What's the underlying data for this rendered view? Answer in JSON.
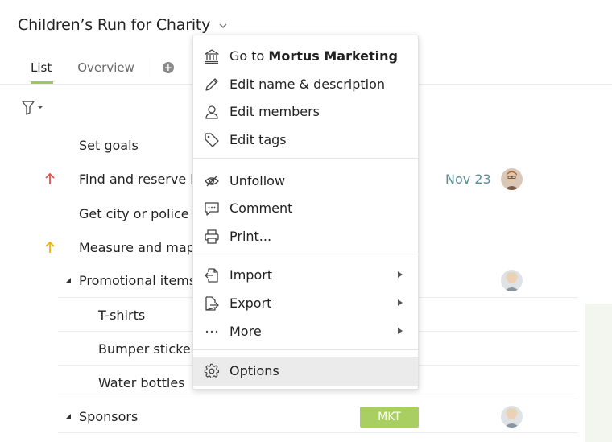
{
  "project": {
    "title": "Children’s Run for Charity"
  },
  "tabs": [
    {
      "label": "List"
    },
    {
      "label": "Overview"
    },
    {
      "label": "+"
    }
  ],
  "tasks": [
    {
      "label": "Set goals"
    },
    {
      "label": "Find and reserve lo",
      "date": "Nov 23",
      "priority": "high"
    },
    {
      "label": "Get city or police ap"
    },
    {
      "label": "Measure and map c",
      "priority": "medium"
    },
    {
      "label": "Promotional items"
    },
    {
      "label": "T-shirts"
    },
    {
      "label": "Bumper stickers"
    },
    {
      "label": "Water bottles"
    },
    {
      "label": "Sponsors",
      "tag": "MKT"
    }
  ],
  "context_menu": {
    "goto_prefix": "Go to ",
    "goto_target": "Mortus Marketing",
    "items": [
      {
        "label": "Edit name & description",
        "icon": "pencil-icon"
      },
      {
        "label": "Edit members",
        "icon": "person-icon"
      },
      {
        "label": "Edit tags",
        "icon": "tag-icon"
      },
      {
        "label": "Unfollow",
        "icon": "unfollow-eye-icon"
      },
      {
        "label": "Comment",
        "icon": "comment-icon"
      },
      {
        "label": "Print...",
        "icon": "printer-icon"
      },
      {
        "label": "Import",
        "icon": "import-icon"
      },
      {
        "label": "Export",
        "icon": "export-icon"
      },
      {
        "label": "More",
        "icon": "more-icon"
      },
      {
        "label": "Options",
        "icon": "gear-icon"
      }
    ]
  },
  "colors": {
    "accent_green": "#9dc95a",
    "tag_green": "#a9cf63",
    "priority_high": "#e0514d",
    "priority_medium": "#f0b400",
    "date_text": "#5d8b93"
  }
}
